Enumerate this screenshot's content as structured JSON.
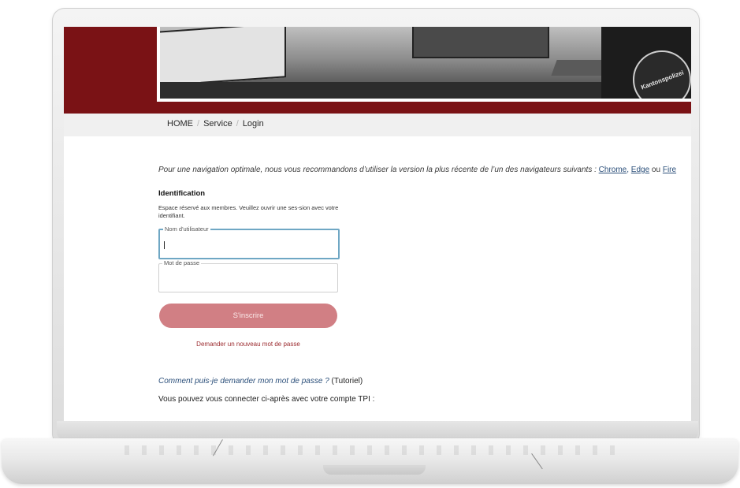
{
  "breadcrumb": {
    "home": "HOME",
    "service": "Service",
    "login": "Login",
    "separator": "/"
  },
  "notice": {
    "text": "Pour une navigation optimale, nous vous recommandons d’utiliser la version la plus récente de l’un des navigateurs suivants : ",
    "chrome": "Chrome",
    "comma": ", ",
    "edge": "Edge",
    "ou": " ou ",
    "firefox": "Fire"
  },
  "identification": {
    "title": "Identification",
    "description": "Espace réservé aux membres. Veuillez ouvrir une ses-sion avec votre identifiant."
  },
  "form": {
    "username_label": "Nom d'utilisateur",
    "username_value": "",
    "password_label": "Mot de passe",
    "password_value": "",
    "submit_label": "S'inscrire",
    "forgot_label": "Demander un nouveau mot de passe"
  },
  "help": {
    "howto_link": "Comment puis-je demander mon mot de passe ?",
    "howto_suffix": " (Tutoriel)",
    "tpi_text": "Vous pouvez vous connecter ci-après avec votre compte TPI :"
  },
  "banner": {
    "badge_text": "Kantonspolizei"
  },
  "colors": {
    "brand_red": "#7a1215",
    "button": "#d17f84",
    "link": "#2b4f7a",
    "focus_border": "#6fa7c4"
  }
}
